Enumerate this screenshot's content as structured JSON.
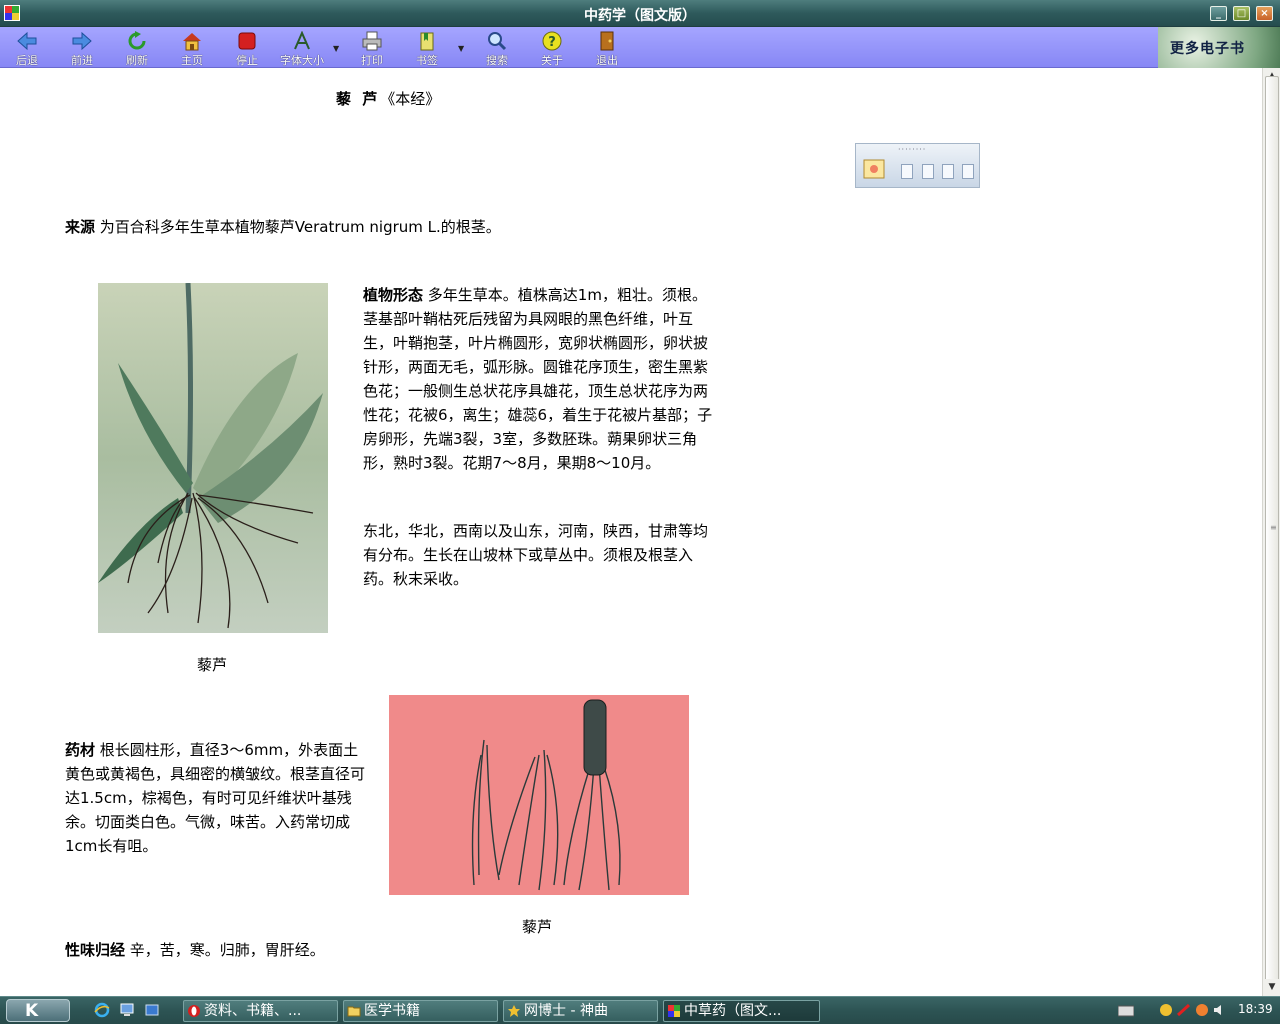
{
  "window": {
    "title": "中药学（图文版）"
  },
  "toolbar": {
    "back": "后退",
    "forward": "前进",
    "refresh": "刷新",
    "home": "主页",
    "stop": "停止",
    "font_size": "字体大小",
    "print": "打印",
    "bookmark": "书签",
    "search": "搜索",
    "about": "关于",
    "exit": "退出"
  },
  "banner": {
    "text": "更多电子书"
  },
  "article": {
    "title_herb": "藜 芦",
    "title_source": "《本经》",
    "source_label": "来源",
    "source_text": " 为百合科多年生草本植物藜芦Veratrum nigrum L.的根茎。",
    "morph_label": "植物形态",
    "morph_text": " 多年生草本。植株高达1m，粗壮。须根。茎基部叶鞘枯死后残留为具网眼的黑色纤维，叶互生，叶鞘抱茎，叶片椭圆形，宽卵状椭圆形，卵状披针形，两面无毛，弧形脉。圆锥花序顶生，密生黑紫色花；一般侧生总状花序具雄花，顶生总状花序为两性花；花被6，离生；雄蕊6，着生于花被片基部；子房卵形，先端3裂，3室，多数胚珠。蒴果卵状三角形，熟时3裂。花期7～8月，果期8～10月。",
    "distribution_text": "东北，华北，西南以及山东，河南，陕西，甘肃等均有分布。生长在山坡林下或草丛中。须根及根茎入药。秋末采收。",
    "caption_plant": "藜芦",
    "material_label": "药材",
    "material_text": " 根长圆柱形，直径3～6mm，外表面土黄色或黄褐色，具细密的横皱纹。根茎直径可达1.5cm，棕褐色，有时可见纤维状叶基残余。切面类白色。气微，味苦。入药常切成1cm长有咀。",
    "caption_material": "藜芦",
    "taste_label": "性味归经",
    "taste_text": " 辛，苦，寒。归肺，胃肝经。"
  },
  "taskbar": {
    "tasks": [
      "资料、书籍、...",
      "医学书籍",
      "网博士 - 神曲",
      "中草药（图文..."
    ],
    "clock": "18:39"
  }
}
